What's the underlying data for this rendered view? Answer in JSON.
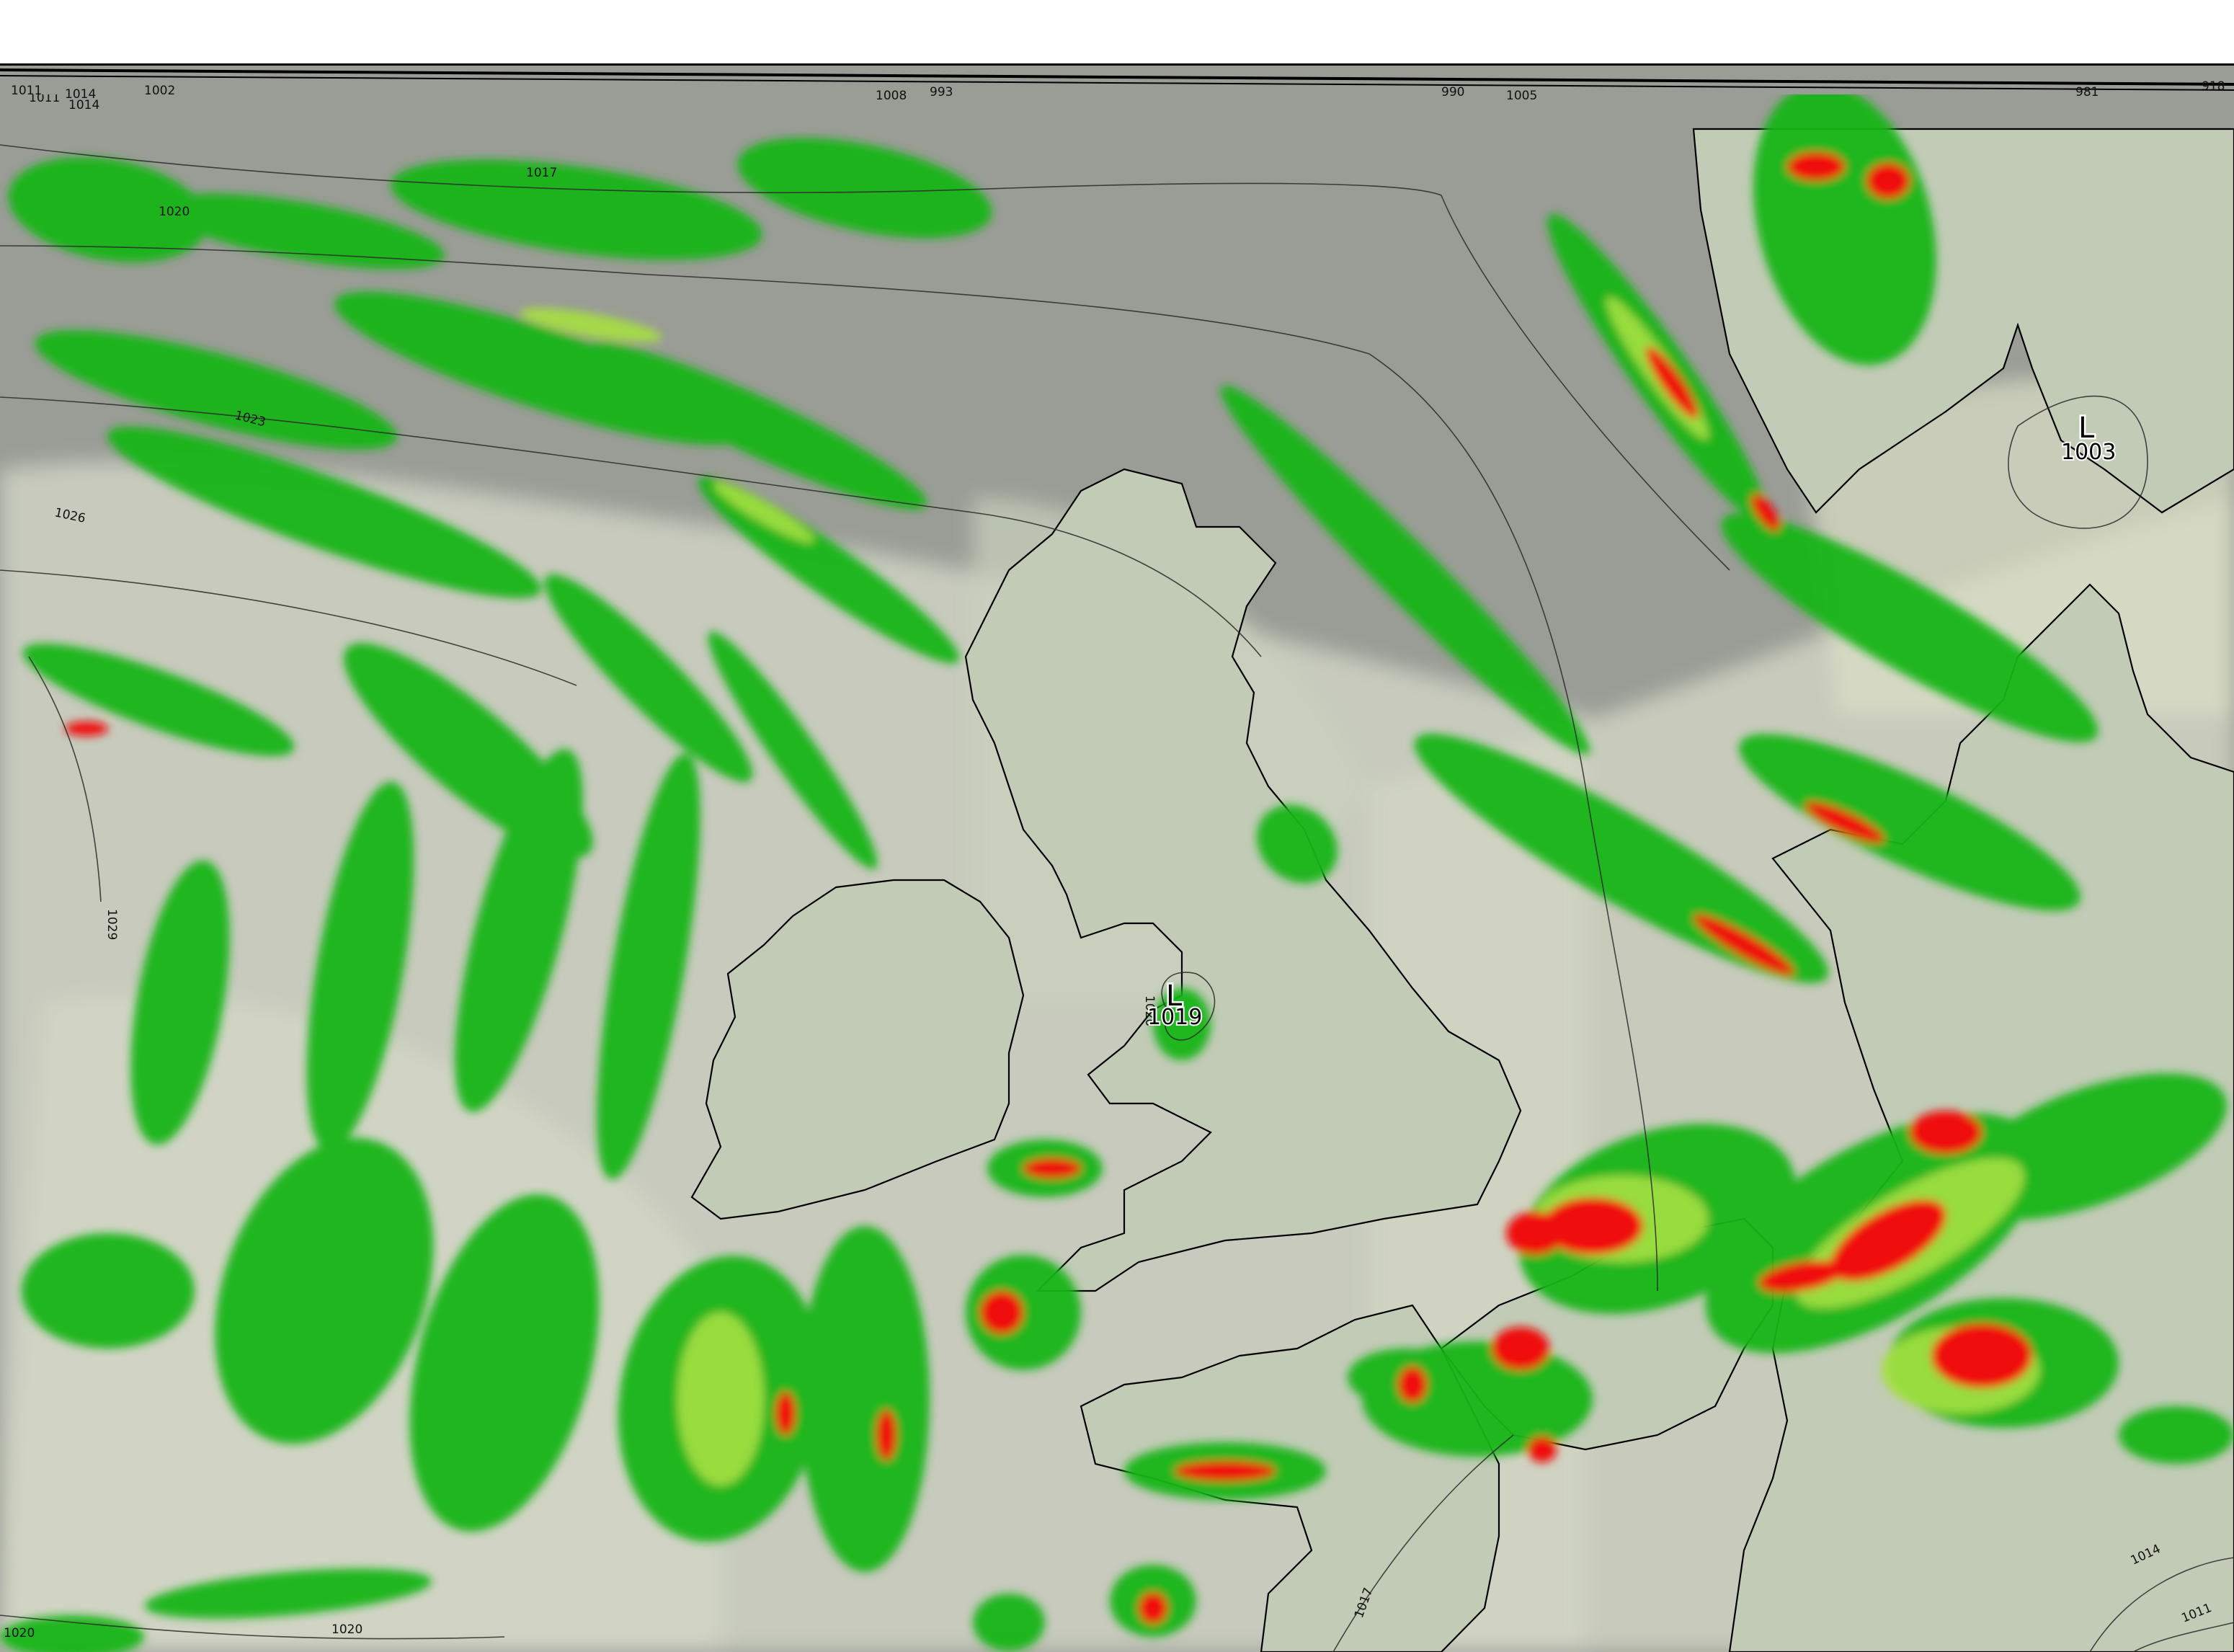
{
  "map": {
    "type": "weather-model-precipitation",
    "colors": {
      "ocean": "#9a9d96",
      "land": "#c7cbb8",
      "cloud": "#d7d9cc",
      "precip_light": "#15b51a",
      "precip_moderate": "#a6e041",
      "precip_heavy_yellow": "#e6df3a",
      "precip_orange": "#f07a2a",
      "precip_red": "#ef0d0d",
      "isobar": "#2a2a2a",
      "coastline": "#000000"
    },
    "pressure_lows": [
      {
        "symbol": "L",
        "value": "1019",
        "location": "Irish Sea"
      },
      {
        "symbol": "L",
        "value": "1003",
        "location": "Southern Scandinavia"
      }
    ],
    "isobar_labels": [
      "1011",
      "1014",
      "1017",
      "1020",
      "1023",
      "1026",
      "1029",
      "1020",
      "1014",
      "1017",
      "1011",
      "1020",
      "1020"
    ],
    "top_edge_labels": [
      "1011",
      "1014",
      "1002",
      "1008",
      "993",
      "1005",
      "990",
      "981",
      "918"
    ],
    "local_isobar_label": "1020"
  }
}
